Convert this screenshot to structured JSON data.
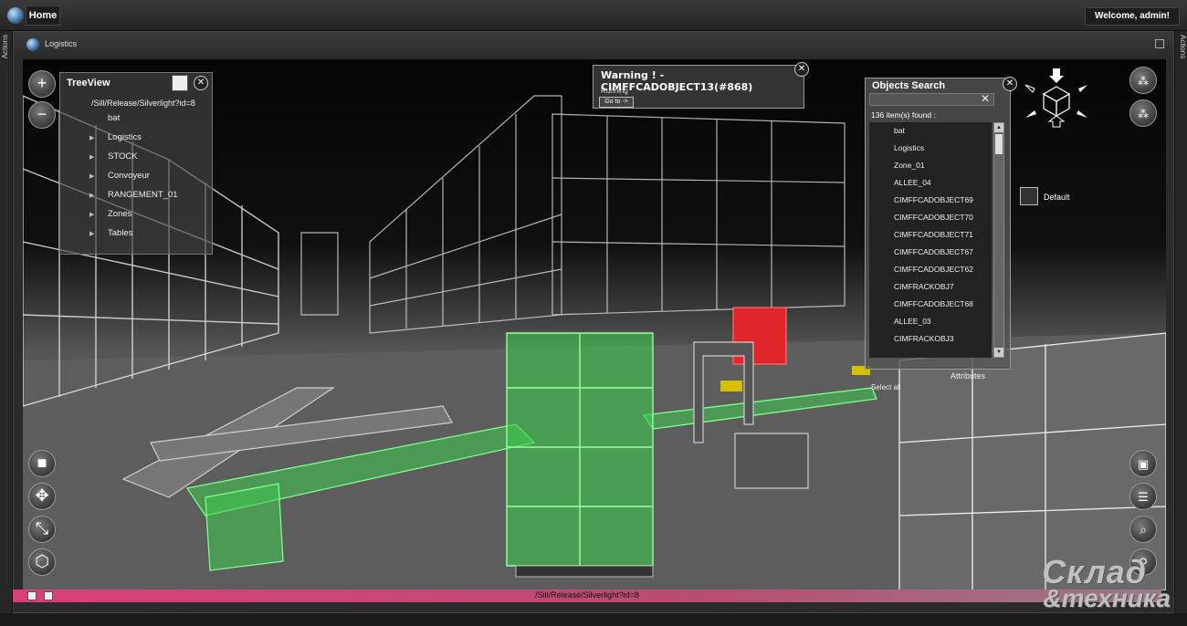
{
  "topbar": {
    "home_tab": "Home",
    "welcome": "Welcome, admin!"
  },
  "side": {
    "left_label": "Actions",
    "right_label": "Actions"
  },
  "window": {
    "title": "Logistics"
  },
  "treeview": {
    "title": "TreeView",
    "path": "/Sill/Release/Silverlight?id=8",
    "items": [
      {
        "label": "bat",
        "expandable": false
      },
      {
        "label": "Logistics",
        "expandable": true
      },
      {
        "label": "STOCK",
        "expandable": true
      },
      {
        "label": "Convoyeur",
        "expandable": true
      },
      {
        "label": "RANGEMENT_01",
        "expandable": true
      },
      {
        "label": "Zones",
        "expandable": true
      },
      {
        "label": "Tables",
        "expandable": true
      }
    ]
  },
  "warning": {
    "title": "Warning ! - CIMFFCADOBJECT13(#868)",
    "status": "Running",
    "goto_label": "Go to ->"
  },
  "objects_search": {
    "title": "Objects Search",
    "search_value": "",
    "count_text": "136 item(s) found :",
    "items": [
      "bat",
      "Logistics",
      "Zone_01",
      "ALLEE_04",
      "CIMFFCADOBJECT69",
      "CIMFFCADOBJECT70",
      "CIMFFCADOBJECT71",
      "CIMFFCADOBJECT67",
      "CIMFFCADOBJECT62",
      "CIMFRACKOBJ7",
      "CIMFFCADOBJECT68",
      "ALLEE_03",
      "CIMFRACKOBJ3"
    ],
    "select_all": "Select all",
    "attributes": "Attributes"
  },
  "legend": {
    "label": "Default"
  },
  "statusbar": {
    "path": "/Sill/Release/Silverlight?id=8"
  },
  "watermark": {
    "line1": "Склад",
    "line2": "&техника"
  },
  "colors": {
    "highlight_green": "#3ec94f",
    "highlight_red": "#e0262a",
    "accent_pink": "#d9407a",
    "highlight_yellow": "#d4c200"
  },
  "icons": {
    "zoom_in": "plus-icon",
    "zoom_out": "minus-icon",
    "cube": "cube-icon",
    "orbit": "orbit-icon",
    "collapse": "collapse-icon",
    "box": "box-icon",
    "layers_up": "layers-up-icon",
    "layers_down": "layers-down-icon",
    "note": "note-icon",
    "comment": "comment-icon",
    "search": "search-icon",
    "location": "location-pin-icon"
  }
}
